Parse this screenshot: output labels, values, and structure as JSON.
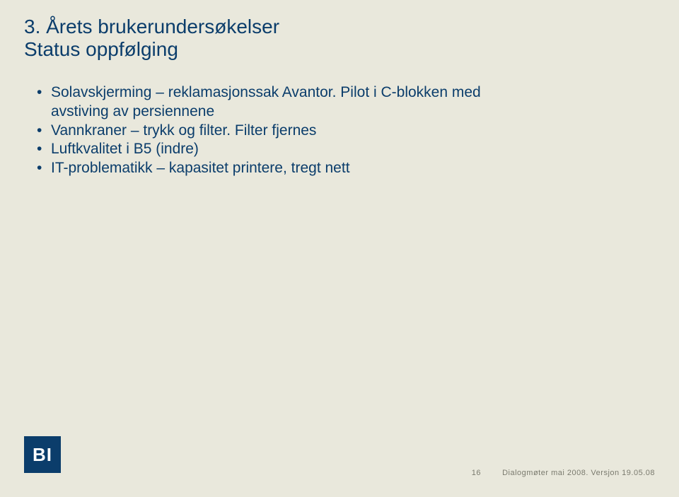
{
  "heading": {
    "line1": "3. Årets brukerundersøkelser",
    "line2": "Status oppfølging"
  },
  "bullets": [
    {
      "text": "Solavskjerming – reklamasjonssak Avantor. Pilot i C-blokken med",
      "cont": "avstiving av persiennene"
    },
    {
      "text": "Vannkraner – trykk og filter. Filter fjernes"
    },
    {
      "text": "Luftkvalitet i B5 (indre)"
    },
    {
      "text": "IT-problematikk – kapasitet printere, tregt nett"
    }
  ],
  "logo": {
    "text": "BI"
  },
  "footer": {
    "page": "16",
    "note": "Dialogmøter mai 2008. Versjon 19.05.08"
  }
}
